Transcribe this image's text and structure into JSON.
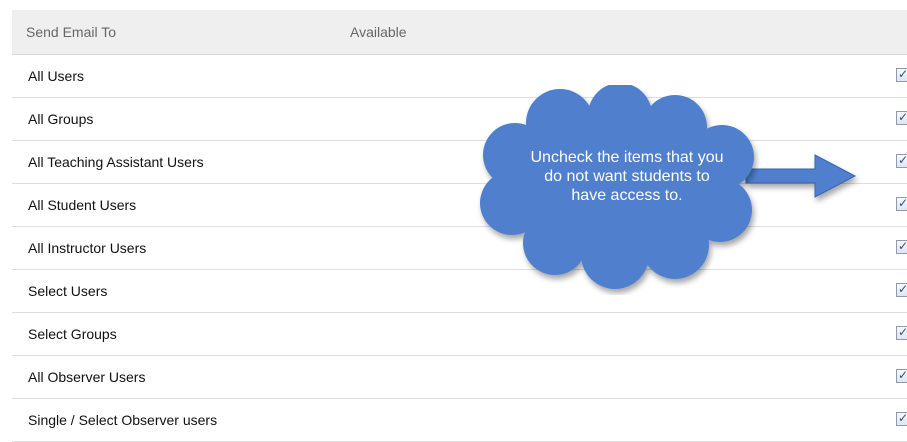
{
  "table": {
    "header": {
      "col1": "Send Email To",
      "col2": "Available"
    },
    "rows": [
      {
        "label": "All Users",
        "checked": true
      },
      {
        "label": "All Groups",
        "checked": true
      },
      {
        "label": "All Teaching Assistant Users",
        "checked": true
      },
      {
        "label": "All Student Users",
        "checked": true
      },
      {
        "label": "All Instructor Users",
        "checked": true
      },
      {
        "label": "Select Users",
        "checked": true
      },
      {
        "label": "Select Groups",
        "checked": true
      },
      {
        "label": "All Observer Users",
        "checked": true
      },
      {
        "label": "Single / Select Observer users",
        "checked": true
      }
    ]
  },
  "callout": {
    "text": "Uncheck the items that you do not want students to have access to.",
    "fill_color": "#4f7fcd",
    "arrow_color": "#4f7fcd"
  }
}
